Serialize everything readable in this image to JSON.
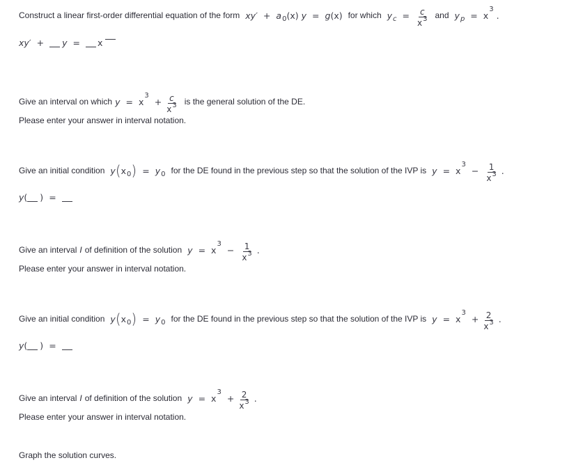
{
  "q1": {
    "prompt_prefix": "Construct a linear first-order differential equation of the form",
    "form": {
      "lhs1": "xy′",
      "plus": "+",
      "a": "a",
      "a_sub": "0",
      "ax": "(x)",
      "y": "y",
      "eq": "=",
      "g": "g",
      "gx": "(x)"
    },
    "for_which": "for which",
    "yc": {
      "y": "y",
      "sub": "c",
      "eq": "=",
      "num": "c",
      "den_base": "x",
      "den_exp": "3"
    },
    "and": "and",
    "yp": {
      "y": "y",
      "sub": "p",
      "eq": "=",
      "base": "x",
      "exp": "3",
      "end": "."
    },
    "answer": {
      "lhs": "xy′",
      "plus": "+",
      "y": "y",
      "eq": "=",
      "x": "x",
      "blank1": "",
      "blank2": "",
      "blank3": ""
    }
  },
  "q2": {
    "prompt_prefix": "Give an interval on which",
    "expr": {
      "y": "y",
      "eq": "=",
      "base": "x",
      "exp": "3",
      "op": "+",
      "num": "c",
      "den_base": "x",
      "den_exp": "3"
    },
    "prompt_suffix": "is the general solution of the DE.",
    "note": "Please enter your answer in interval notation."
  },
  "q3": {
    "prompt_prefix": "Give an initial condition",
    "ic": {
      "y": "y",
      "lp": "(",
      "x": "x",
      "sub": "0",
      "rp": ")",
      "eq": "=",
      "y0": "y",
      "y0sub": "0"
    },
    "prompt_mid": "for the DE found in the previous step so that the solution of the IVP is",
    "expr": {
      "y": "y",
      "eq": "=",
      "base": "x",
      "exp": "3",
      "op": "−",
      "num": "1",
      "den_base": "x",
      "den_exp": "3",
      "end": "."
    },
    "answer": {
      "y": "y",
      "lp": "(",
      "rp": ")",
      "eq": "=",
      "x0": "",
      "y0": ""
    }
  },
  "q4": {
    "prompt_prefix": "Give an interval",
    "I": "I",
    "prompt_mid": "of definition of the solution",
    "expr": {
      "y": "y",
      "eq": "=",
      "base": "x",
      "exp": "3",
      "op": "−",
      "num": "1",
      "den_base": "x",
      "den_exp": "3",
      "end": "."
    },
    "note": "Please enter your answer in interval notation."
  },
  "q5": {
    "prompt_prefix": "Give an initial condition",
    "ic": {
      "y": "y",
      "lp": "(",
      "x": "x",
      "sub": "0",
      "rp": ")",
      "eq": "=",
      "y0": "y",
      "y0sub": "0"
    },
    "prompt_mid": "for the DE found in the previous step so that the solution of the IVP is",
    "expr": {
      "y": "y",
      "eq": "=",
      "base": "x",
      "exp": "3",
      "op": "+",
      "num": "2",
      "den_base": "x",
      "den_exp": "3",
      "end": "."
    },
    "answer": {
      "y": "y",
      "lp": "(",
      "rp": ")",
      "eq": "=",
      "x0": "",
      "y0": ""
    }
  },
  "q6": {
    "prompt_prefix": "Give an interval",
    "I": "I",
    "prompt_mid": "of definition of the solution",
    "expr": {
      "y": "y",
      "eq": "=",
      "base": "x",
      "exp": "3",
      "op": "+",
      "num": "2",
      "den_base": "x",
      "den_exp": "3",
      "end": "."
    },
    "note": "Please enter your answer in interval notation."
  },
  "q7": {
    "prompt": "Graph the solution curves."
  }
}
